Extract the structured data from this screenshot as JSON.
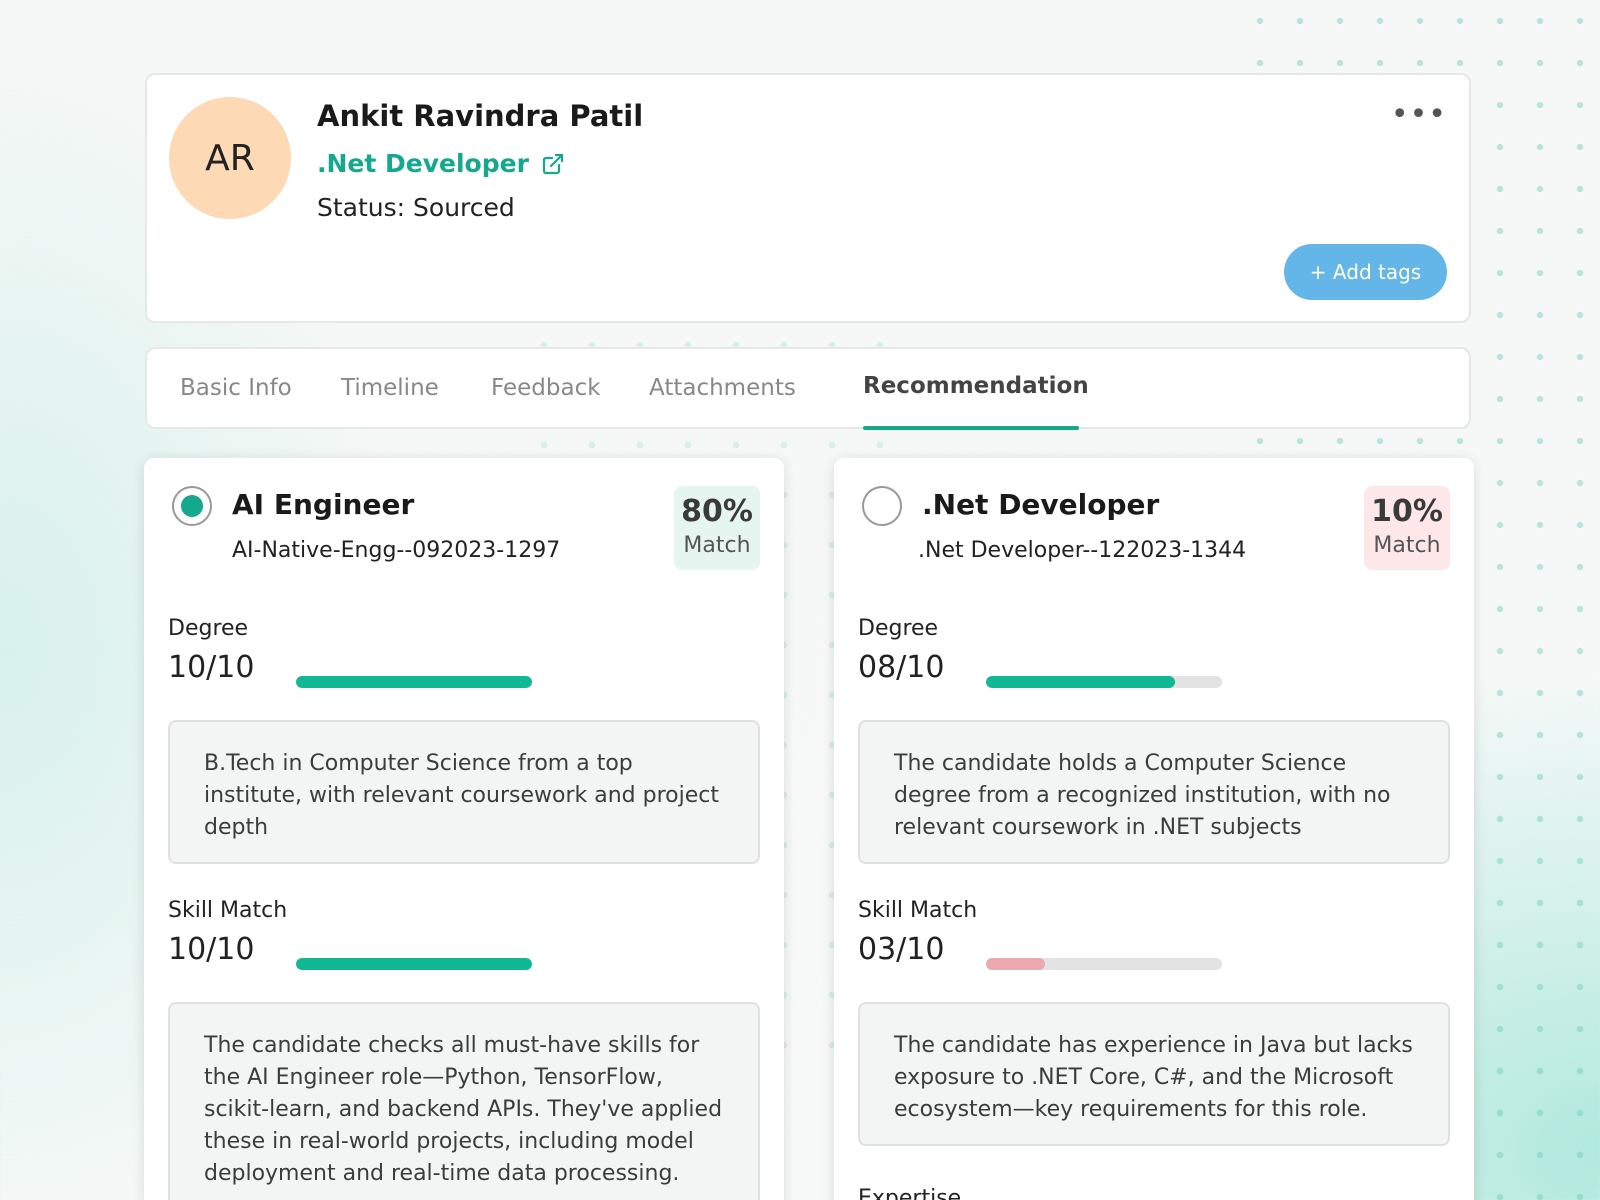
{
  "candidate": {
    "initials": "AR",
    "name": "Ankit Ravindra Patil",
    "role": ".Net Developer",
    "status": "Status: Sourced",
    "menu_glyph": "•••",
    "add_tags_label": "+ Add tags"
  },
  "tabs": [
    {
      "label": "Basic Info",
      "active": false
    },
    {
      "label": "Timeline",
      "active": false
    },
    {
      "label": "Feedback",
      "active": false
    },
    {
      "label": "Attachments",
      "active": false
    },
    {
      "label": "Recommendation",
      "active": true
    }
  ],
  "recommendations": [
    {
      "selected": true,
      "title": "AI Engineer",
      "code": "AI-Native-Engg--092023-1297",
      "match_pct": "80%",
      "match_label": "Match",
      "match_color": "#e7f5f1",
      "metrics": [
        {
          "label": "Degree",
          "score": "10/10",
          "fraction": 1.0,
          "description": "B.Tech in Computer Science from a top institute, with relevant coursework and project depth"
        },
        {
          "label": "Skill Match",
          "score": "10/10",
          "fraction": 1.0,
          "description": "The candidate checks all must-have skills for the AI Engineer role—Python, TensorFlow, scikit-learn, and backend APIs. They've applied these in real-world projects, including model deployment and real-time data processing."
        }
      ]
    },
    {
      "selected": false,
      "title": ".Net Developer",
      "code": ".Net Developer--122023-1344",
      "match_pct": "10%",
      "match_label": "Match",
      "match_color": "#fde7e9",
      "metrics": [
        {
          "label": "Degree",
          "score": "08/10",
          "fraction": 0.8,
          "description": "The candidate holds a Computer Science degree from a recognized institution, with no relevant coursework in .NET subjects"
        },
        {
          "label": "Skill Match",
          "score": "03/10",
          "fraction": 0.25,
          "description": "The candidate has experience in Java but lacks exposure to .NET Core, C#, and the Microsoft ecosystem—key requirements for this role."
        }
      ],
      "next_section_label": "Expertise"
    }
  ],
  "colors": {
    "accent": "#14a88c",
    "bar_good": "#10b893",
    "bar_low": "#eca9b0",
    "add_tags_bg": "#64b5e8",
    "avatar_bg": "#fdd9b5"
  },
  "icons": {
    "external_link": "external-link-icon",
    "radio_selected": "radio-checked-icon",
    "radio_unselected": "radio-unchecked-icon",
    "menu": "more-horizontal-icon"
  }
}
